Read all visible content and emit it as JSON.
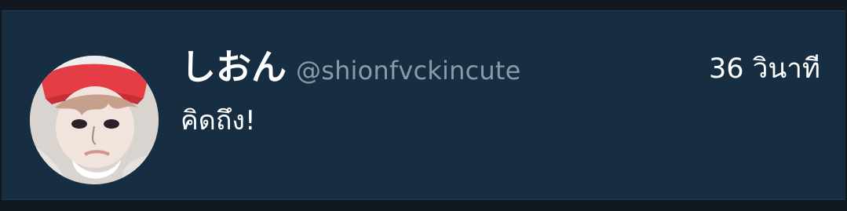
{
  "tweet": {
    "display_name": "しおん",
    "handle": "@shionfvckincute",
    "timestamp": "36 วินาที",
    "text": "คิดถึง!",
    "avatar": "profile-photo"
  },
  "colors": {
    "background": "#111820",
    "card": "#172d42",
    "text": "#ffffff",
    "muted": "#8c9aa8",
    "avatar_hat": "#e33b43"
  }
}
